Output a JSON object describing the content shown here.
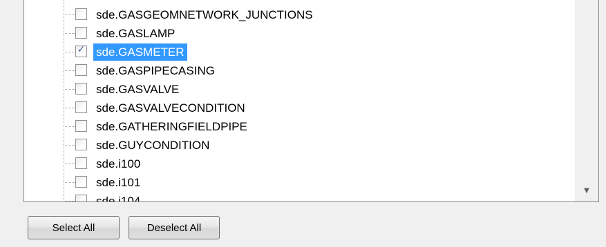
{
  "tree": {
    "items": [
      {
        "label": "sde.GASGEOMNETWORK_JUNCTIONS",
        "checked": false,
        "selected": false
      },
      {
        "label": "sde.GASLAMP",
        "checked": false,
        "selected": false
      },
      {
        "label": "sde.GASMETER",
        "checked": true,
        "selected": true
      },
      {
        "label": "sde.GASPIPECASING",
        "checked": false,
        "selected": false
      },
      {
        "label": "sde.GASVALVE",
        "checked": false,
        "selected": false
      },
      {
        "label": "sde.GASVALVECONDITION",
        "checked": false,
        "selected": false
      },
      {
        "label": "sde.GATHERINGFIELDPIPE",
        "checked": false,
        "selected": false
      },
      {
        "label": "sde.GUYCONDITION",
        "checked": false,
        "selected": false
      },
      {
        "label": "sde.i100",
        "checked": false,
        "selected": false
      },
      {
        "label": "sde.i101",
        "checked": false,
        "selected": false
      },
      {
        "label": "sde.i104",
        "checked": false,
        "selected": false
      }
    ]
  },
  "buttons": {
    "select_all": "Select All",
    "deselect_all": "Deselect All"
  },
  "icons": {
    "checkmark": "✓",
    "scroll_down": "▼"
  },
  "colors": {
    "selection": "#3399ff",
    "border": "#828790"
  }
}
